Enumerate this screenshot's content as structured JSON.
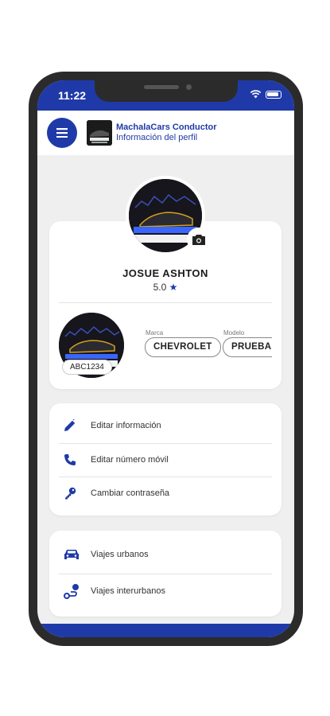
{
  "status": {
    "time": "11:22"
  },
  "header": {
    "title": "MachalaCars Conductor",
    "subtitle": "Información del perfil"
  },
  "profile": {
    "name": "JOSUE ASHTON",
    "rating": "5.0"
  },
  "vehicle": {
    "plate": "ABC1234",
    "marca_label": "Marca",
    "marca": "CHEVROLET",
    "modelo_label": "Modelo",
    "modelo": "PRUEBAS"
  },
  "actions": [
    {
      "label": "Editar información",
      "icon": "pencil-icon"
    },
    {
      "label": "Editar número móvil",
      "icon": "phone-icon"
    },
    {
      "label": "Cambiar contraseña",
      "icon": "key-icon"
    }
  ],
  "trips": [
    {
      "label": "Viajes urbanos",
      "icon": "car-icon"
    },
    {
      "label": "Viajes interurbanos",
      "icon": "route-icon"
    }
  ],
  "colors": {
    "primary": "#1f3aa8",
    "background": "#efefef"
  }
}
